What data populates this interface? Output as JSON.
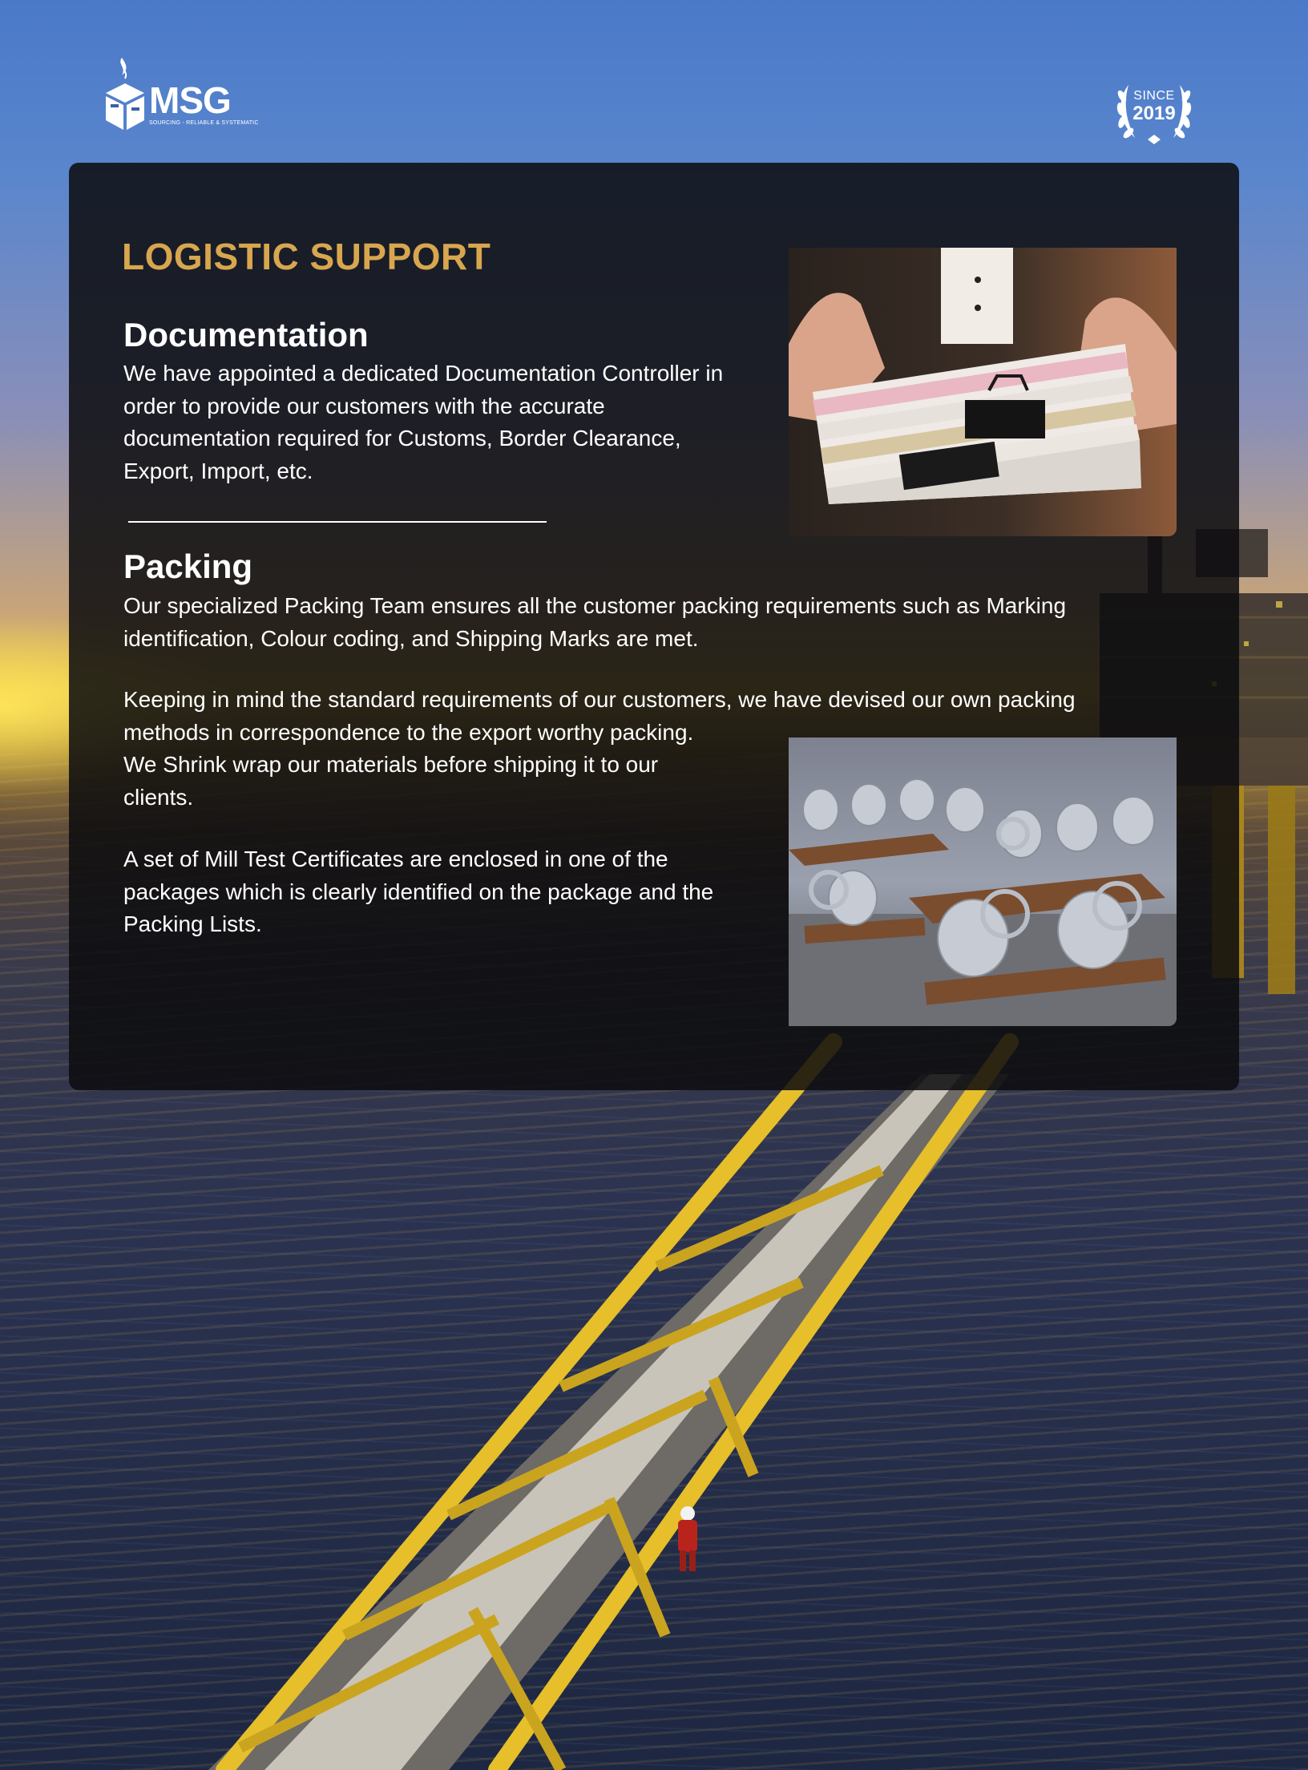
{
  "brand": {
    "name": "MSG",
    "tagline": "SOURCING - RELIABLE & SYSTEMATIC",
    "badge_since": "SINCE",
    "badge_year": "2019"
  },
  "page": {
    "title": "LOGISTIC SUPPORT"
  },
  "documentation": {
    "heading": "Documentation",
    "lines": [
      "We have appointed a dedicated Documentation Controller in",
      "order to provide our customers with the accurate",
      "documentation required for Customs, Border Clearance,",
      "Export, Import, etc."
    ]
  },
  "packing": {
    "heading": "Packing",
    "paragraph_1": [
      "Our specialized Packing Team ensures all the customer packing requirements such as Marking",
      "identification, Colour coding, and Shipping Marks are met."
    ],
    "paragraph_2": [
      "Keeping in mind the standard requirements of our customers, we have devised our own packing",
      "methods in correspondence to the export worthy packing.",
      "We Shrink wrap our materials before shipping it to our",
      "clients."
    ],
    "paragraph_3": [
      "A set of Mill Test Certificates are enclosed in one of the",
      "packages which is clearly identified on the package and the",
      "Packing Lists."
    ]
  },
  "colors": {
    "accent_gold": "#d8a64e",
    "panel": "#0c0c0e",
    "text": "#ffffff"
  }
}
